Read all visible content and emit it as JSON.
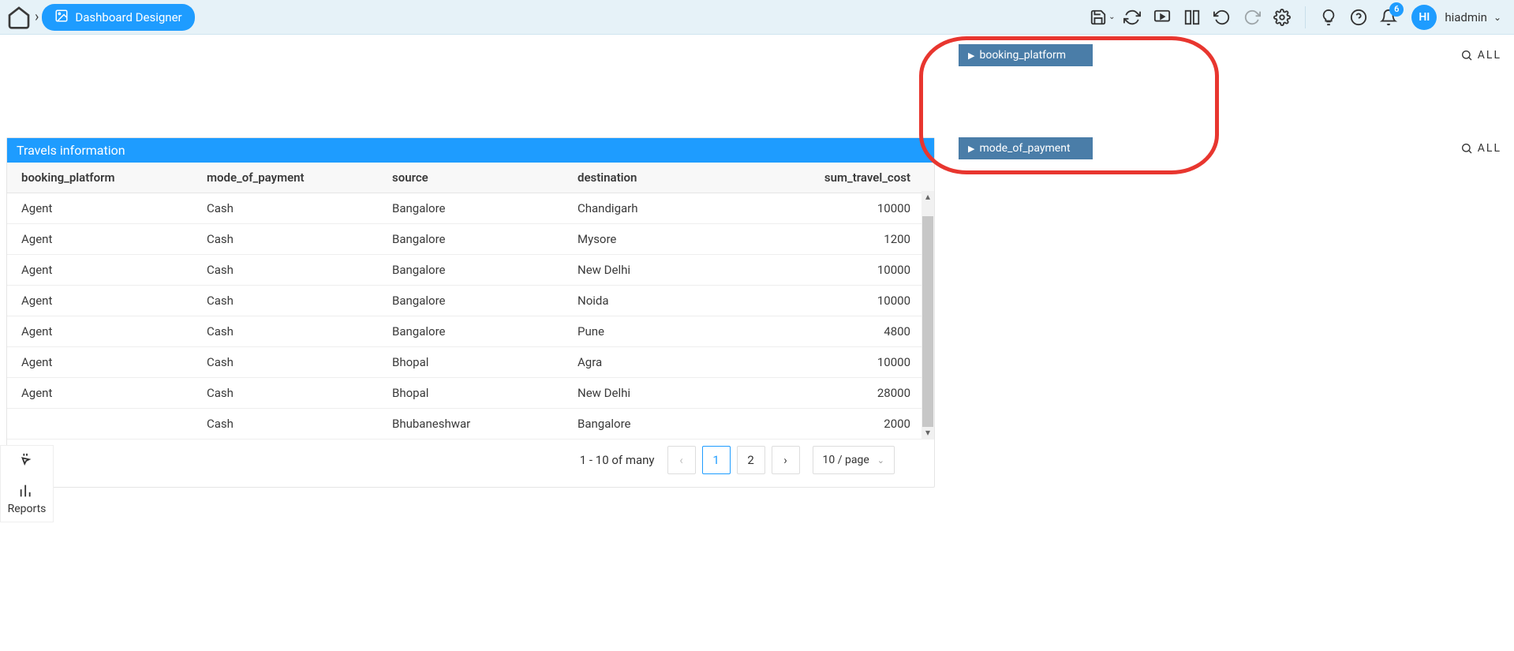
{
  "header": {
    "breadcrumb_current": "Dashboard Designer",
    "notification_count": "6",
    "avatar_initials": "HI",
    "username": "hiadmin"
  },
  "card": {
    "title": "Travels information"
  },
  "table": {
    "columns": [
      "booking_platform",
      "mode_of_payment",
      "source",
      "destination",
      "sum_travel_cost"
    ],
    "rows": [
      {
        "booking_platform": "Agent",
        "mode_of_payment": "Cash",
        "source": "Bangalore",
        "destination": "Chandigarh",
        "sum_travel_cost": "10000"
      },
      {
        "booking_platform": "Agent",
        "mode_of_payment": "Cash",
        "source": "Bangalore",
        "destination": "Mysore",
        "sum_travel_cost": "1200"
      },
      {
        "booking_platform": "Agent",
        "mode_of_payment": "Cash",
        "source": "Bangalore",
        "destination": "New Delhi",
        "sum_travel_cost": "10000"
      },
      {
        "booking_platform": "Agent",
        "mode_of_payment": "Cash",
        "source": "Bangalore",
        "destination": "Noida",
        "sum_travel_cost": "10000"
      },
      {
        "booking_platform": "Agent",
        "mode_of_payment": "Cash",
        "source": "Bangalore",
        "destination": "Pune",
        "sum_travel_cost": "4800"
      },
      {
        "booking_platform": "Agent",
        "mode_of_payment": "Cash",
        "source": "Bhopal",
        "destination": "Agra",
        "sum_travel_cost": "10000"
      },
      {
        "booking_platform": "Agent",
        "mode_of_payment": "Cash",
        "source": "Bhopal",
        "destination": "New Delhi",
        "sum_travel_cost": "28000"
      },
      {
        "booking_platform": "",
        "mode_of_payment": "Cash",
        "source": "Bhubaneshwar",
        "destination": "Bangalore",
        "sum_travel_cost": "2000"
      }
    ]
  },
  "pagination": {
    "info": "1 - 10 of many",
    "pages": [
      "1",
      "2"
    ],
    "active": "1",
    "page_size": "10 / page"
  },
  "filters": [
    {
      "label": "booking_platform",
      "scope": "ALL"
    },
    {
      "label": "mode_of_payment",
      "scope": "ALL"
    }
  ],
  "side_toolbar": {
    "reports": "Reports"
  }
}
